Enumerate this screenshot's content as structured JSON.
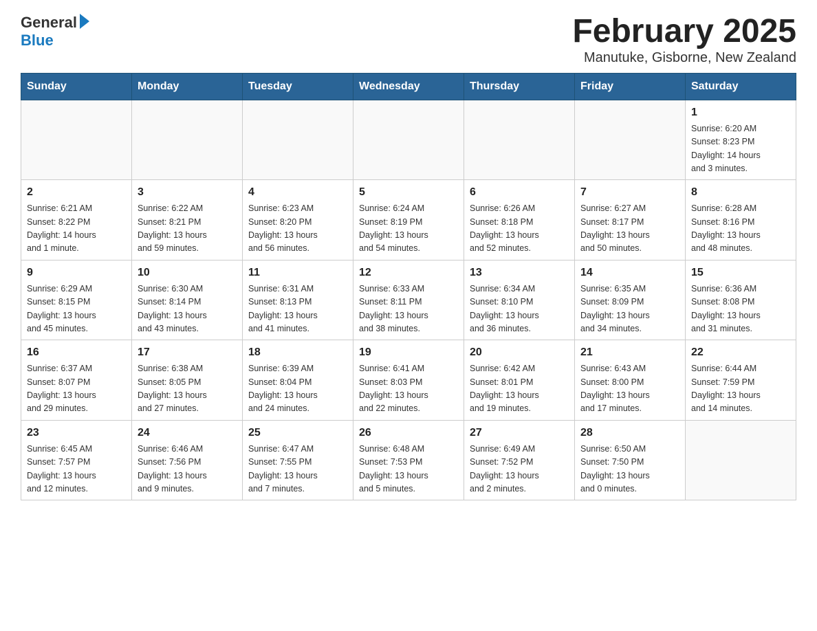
{
  "header": {
    "logo_general": "General",
    "logo_blue": "Blue",
    "title": "February 2025",
    "subtitle": "Manutuke, Gisborne, New Zealand"
  },
  "weekdays": [
    "Sunday",
    "Monday",
    "Tuesday",
    "Wednesday",
    "Thursday",
    "Friday",
    "Saturday"
  ],
  "weeks": [
    [
      {
        "day": "",
        "info": ""
      },
      {
        "day": "",
        "info": ""
      },
      {
        "day": "",
        "info": ""
      },
      {
        "day": "",
        "info": ""
      },
      {
        "day": "",
        "info": ""
      },
      {
        "day": "",
        "info": ""
      },
      {
        "day": "1",
        "info": "Sunrise: 6:20 AM\nSunset: 8:23 PM\nDaylight: 14 hours\nand 3 minutes."
      }
    ],
    [
      {
        "day": "2",
        "info": "Sunrise: 6:21 AM\nSunset: 8:22 PM\nDaylight: 14 hours\nand 1 minute."
      },
      {
        "day": "3",
        "info": "Sunrise: 6:22 AM\nSunset: 8:21 PM\nDaylight: 13 hours\nand 59 minutes."
      },
      {
        "day": "4",
        "info": "Sunrise: 6:23 AM\nSunset: 8:20 PM\nDaylight: 13 hours\nand 56 minutes."
      },
      {
        "day": "5",
        "info": "Sunrise: 6:24 AM\nSunset: 8:19 PM\nDaylight: 13 hours\nand 54 minutes."
      },
      {
        "day": "6",
        "info": "Sunrise: 6:26 AM\nSunset: 8:18 PM\nDaylight: 13 hours\nand 52 minutes."
      },
      {
        "day": "7",
        "info": "Sunrise: 6:27 AM\nSunset: 8:17 PM\nDaylight: 13 hours\nand 50 minutes."
      },
      {
        "day": "8",
        "info": "Sunrise: 6:28 AM\nSunset: 8:16 PM\nDaylight: 13 hours\nand 48 minutes."
      }
    ],
    [
      {
        "day": "9",
        "info": "Sunrise: 6:29 AM\nSunset: 8:15 PM\nDaylight: 13 hours\nand 45 minutes."
      },
      {
        "day": "10",
        "info": "Sunrise: 6:30 AM\nSunset: 8:14 PM\nDaylight: 13 hours\nand 43 minutes."
      },
      {
        "day": "11",
        "info": "Sunrise: 6:31 AM\nSunset: 8:13 PM\nDaylight: 13 hours\nand 41 minutes."
      },
      {
        "day": "12",
        "info": "Sunrise: 6:33 AM\nSunset: 8:11 PM\nDaylight: 13 hours\nand 38 minutes."
      },
      {
        "day": "13",
        "info": "Sunrise: 6:34 AM\nSunset: 8:10 PM\nDaylight: 13 hours\nand 36 minutes."
      },
      {
        "day": "14",
        "info": "Sunrise: 6:35 AM\nSunset: 8:09 PM\nDaylight: 13 hours\nand 34 minutes."
      },
      {
        "day": "15",
        "info": "Sunrise: 6:36 AM\nSunset: 8:08 PM\nDaylight: 13 hours\nand 31 minutes."
      }
    ],
    [
      {
        "day": "16",
        "info": "Sunrise: 6:37 AM\nSunset: 8:07 PM\nDaylight: 13 hours\nand 29 minutes."
      },
      {
        "day": "17",
        "info": "Sunrise: 6:38 AM\nSunset: 8:05 PM\nDaylight: 13 hours\nand 27 minutes."
      },
      {
        "day": "18",
        "info": "Sunrise: 6:39 AM\nSunset: 8:04 PM\nDaylight: 13 hours\nand 24 minutes."
      },
      {
        "day": "19",
        "info": "Sunrise: 6:41 AM\nSunset: 8:03 PM\nDaylight: 13 hours\nand 22 minutes."
      },
      {
        "day": "20",
        "info": "Sunrise: 6:42 AM\nSunset: 8:01 PM\nDaylight: 13 hours\nand 19 minutes."
      },
      {
        "day": "21",
        "info": "Sunrise: 6:43 AM\nSunset: 8:00 PM\nDaylight: 13 hours\nand 17 minutes."
      },
      {
        "day": "22",
        "info": "Sunrise: 6:44 AM\nSunset: 7:59 PM\nDaylight: 13 hours\nand 14 minutes."
      }
    ],
    [
      {
        "day": "23",
        "info": "Sunrise: 6:45 AM\nSunset: 7:57 PM\nDaylight: 13 hours\nand 12 minutes."
      },
      {
        "day": "24",
        "info": "Sunrise: 6:46 AM\nSunset: 7:56 PM\nDaylight: 13 hours\nand 9 minutes."
      },
      {
        "day": "25",
        "info": "Sunrise: 6:47 AM\nSunset: 7:55 PM\nDaylight: 13 hours\nand 7 minutes."
      },
      {
        "day": "26",
        "info": "Sunrise: 6:48 AM\nSunset: 7:53 PM\nDaylight: 13 hours\nand 5 minutes."
      },
      {
        "day": "27",
        "info": "Sunrise: 6:49 AM\nSunset: 7:52 PM\nDaylight: 13 hours\nand 2 minutes."
      },
      {
        "day": "28",
        "info": "Sunrise: 6:50 AM\nSunset: 7:50 PM\nDaylight: 13 hours\nand 0 minutes."
      },
      {
        "day": "",
        "info": ""
      }
    ]
  ]
}
